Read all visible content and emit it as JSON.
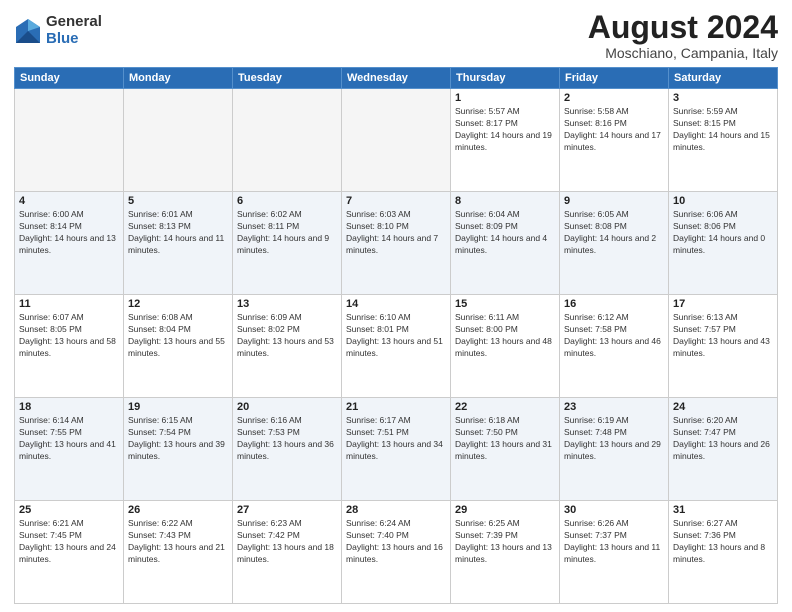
{
  "header": {
    "logo_general": "General",
    "logo_blue": "Blue",
    "title": "August 2024",
    "location": "Moschiano, Campania, Italy"
  },
  "days_of_week": [
    "Sunday",
    "Monday",
    "Tuesday",
    "Wednesday",
    "Thursday",
    "Friday",
    "Saturday"
  ],
  "weeks": [
    [
      {
        "day": "",
        "empty": true
      },
      {
        "day": "",
        "empty": true
      },
      {
        "day": "",
        "empty": true
      },
      {
        "day": "",
        "empty": true
      },
      {
        "day": "1",
        "sunrise": "5:57 AM",
        "sunset": "8:17 PM",
        "daylight": "14 hours and 19 minutes."
      },
      {
        "day": "2",
        "sunrise": "5:58 AM",
        "sunset": "8:16 PM",
        "daylight": "14 hours and 17 minutes."
      },
      {
        "day": "3",
        "sunrise": "5:59 AM",
        "sunset": "8:15 PM",
        "daylight": "14 hours and 15 minutes."
      }
    ],
    [
      {
        "day": "4",
        "sunrise": "6:00 AM",
        "sunset": "8:14 PM",
        "daylight": "14 hours and 13 minutes."
      },
      {
        "day": "5",
        "sunrise": "6:01 AM",
        "sunset": "8:13 PM",
        "daylight": "14 hours and 11 minutes."
      },
      {
        "day": "6",
        "sunrise": "6:02 AM",
        "sunset": "8:11 PM",
        "daylight": "14 hours and 9 minutes."
      },
      {
        "day": "7",
        "sunrise": "6:03 AM",
        "sunset": "8:10 PM",
        "daylight": "14 hours and 7 minutes."
      },
      {
        "day": "8",
        "sunrise": "6:04 AM",
        "sunset": "8:09 PM",
        "daylight": "14 hours and 4 minutes."
      },
      {
        "day": "9",
        "sunrise": "6:05 AM",
        "sunset": "8:08 PM",
        "daylight": "14 hours and 2 minutes."
      },
      {
        "day": "10",
        "sunrise": "6:06 AM",
        "sunset": "8:06 PM",
        "daylight": "14 hours and 0 minutes."
      }
    ],
    [
      {
        "day": "11",
        "sunrise": "6:07 AM",
        "sunset": "8:05 PM",
        "daylight": "13 hours and 58 minutes."
      },
      {
        "day": "12",
        "sunrise": "6:08 AM",
        "sunset": "8:04 PM",
        "daylight": "13 hours and 55 minutes."
      },
      {
        "day": "13",
        "sunrise": "6:09 AM",
        "sunset": "8:02 PM",
        "daylight": "13 hours and 53 minutes."
      },
      {
        "day": "14",
        "sunrise": "6:10 AM",
        "sunset": "8:01 PM",
        "daylight": "13 hours and 51 minutes."
      },
      {
        "day": "15",
        "sunrise": "6:11 AM",
        "sunset": "8:00 PM",
        "daylight": "13 hours and 48 minutes."
      },
      {
        "day": "16",
        "sunrise": "6:12 AM",
        "sunset": "7:58 PM",
        "daylight": "13 hours and 46 minutes."
      },
      {
        "day": "17",
        "sunrise": "6:13 AM",
        "sunset": "7:57 PM",
        "daylight": "13 hours and 43 minutes."
      }
    ],
    [
      {
        "day": "18",
        "sunrise": "6:14 AM",
        "sunset": "7:55 PM",
        "daylight": "13 hours and 41 minutes."
      },
      {
        "day": "19",
        "sunrise": "6:15 AM",
        "sunset": "7:54 PM",
        "daylight": "13 hours and 39 minutes."
      },
      {
        "day": "20",
        "sunrise": "6:16 AM",
        "sunset": "7:53 PM",
        "daylight": "13 hours and 36 minutes."
      },
      {
        "day": "21",
        "sunrise": "6:17 AM",
        "sunset": "7:51 PM",
        "daylight": "13 hours and 34 minutes."
      },
      {
        "day": "22",
        "sunrise": "6:18 AM",
        "sunset": "7:50 PM",
        "daylight": "13 hours and 31 minutes."
      },
      {
        "day": "23",
        "sunrise": "6:19 AM",
        "sunset": "7:48 PM",
        "daylight": "13 hours and 29 minutes."
      },
      {
        "day": "24",
        "sunrise": "6:20 AM",
        "sunset": "7:47 PM",
        "daylight": "13 hours and 26 minutes."
      }
    ],
    [
      {
        "day": "25",
        "sunrise": "6:21 AM",
        "sunset": "7:45 PM",
        "daylight": "13 hours and 24 minutes."
      },
      {
        "day": "26",
        "sunrise": "6:22 AM",
        "sunset": "7:43 PM",
        "daylight": "13 hours and 21 minutes."
      },
      {
        "day": "27",
        "sunrise": "6:23 AM",
        "sunset": "7:42 PM",
        "daylight": "13 hours and 18 minutes."
      },
      {
        "day": "28",
        "sunrise": "6:24 AM",
        "sunset": "7:40 PM",
        "daylight": "13 hours and 16 minutes."
      },
      {
        "day": "29",
        "sunrise": "6:25 AM",
        "sunset": "7:39 PM",
        "daylight": "13 hours and 13 minutes."
      },
      {
        "day": "30",
        "sunrise": "6:26 AM",
        "sunset": "7:37 PM",
        "daylight": "13 hours and 11 minutes."
      },
      {
        "day": "31",
        "sunrise": "6:27 AM",
        "sunset": "7:36 PM",
        "daylight": "13 hours and 8 minutes."
      }
    ]
  ]
}
